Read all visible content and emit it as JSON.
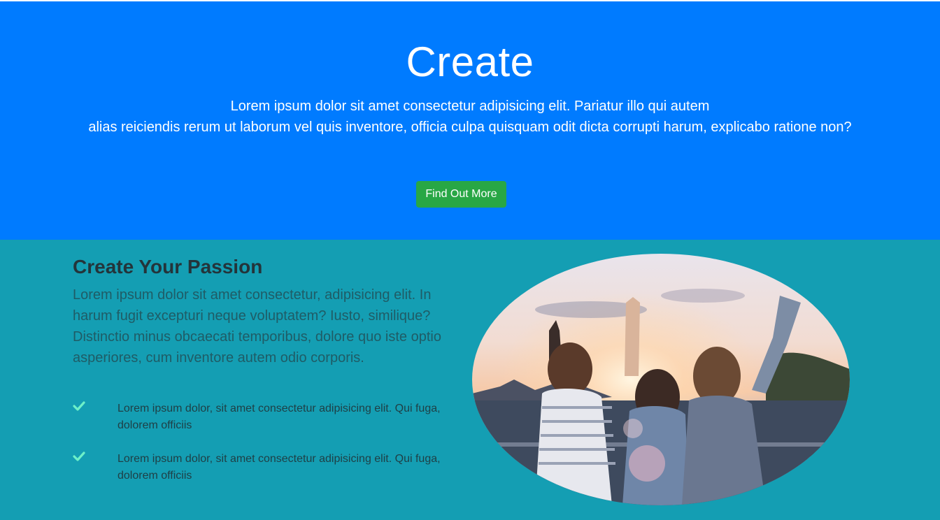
{
  "hero": {
    "title": "Create",
    "lead_line1": "Lorem ipsum dolor sit amet consectetur adipisicing elit. Pariatur illo qui autem",
    "lead_line2": "alias reiciendis rerum ut laborum vel quis inventore, officia culpa quisquam odit dicta corrupti harum, explicabo ratione non?",
    "cta_label": "Find Out More"
  },
  "feature": {
    "title": "Create Your Passion",
    "description": "Lorem ipsum dolor sit amet consectetur, adipisicing elit. In harum fugit excepturi neque voluptatem? Iusto, similique? Distinctio minus obcaecati temporibus, dolore quo iste optio asperiores, cum inventore autem odio corporis.",
    "items": [
      {
        "icon": "check-icon",
        "text": "Lorem ipsum dolor, sit amet consectetur adipisicing elit. Qui fuga, dolorem officiis"
      },
      {
        "icon": "check-icon",
        "text": "Lorem ipsum dolor, sit amet consectetur adipisicing elit. Qui fuga, dolorem officiis"
      }
    ],
    "image": "friends-sunset-photo"
  },
  "colors": {
    "hero_bg": "#007bff",
    "cta_bg": "#28a745",
    "feature_bg": "#149eb3",
    "check": "#6ef0c8"
  }
}
